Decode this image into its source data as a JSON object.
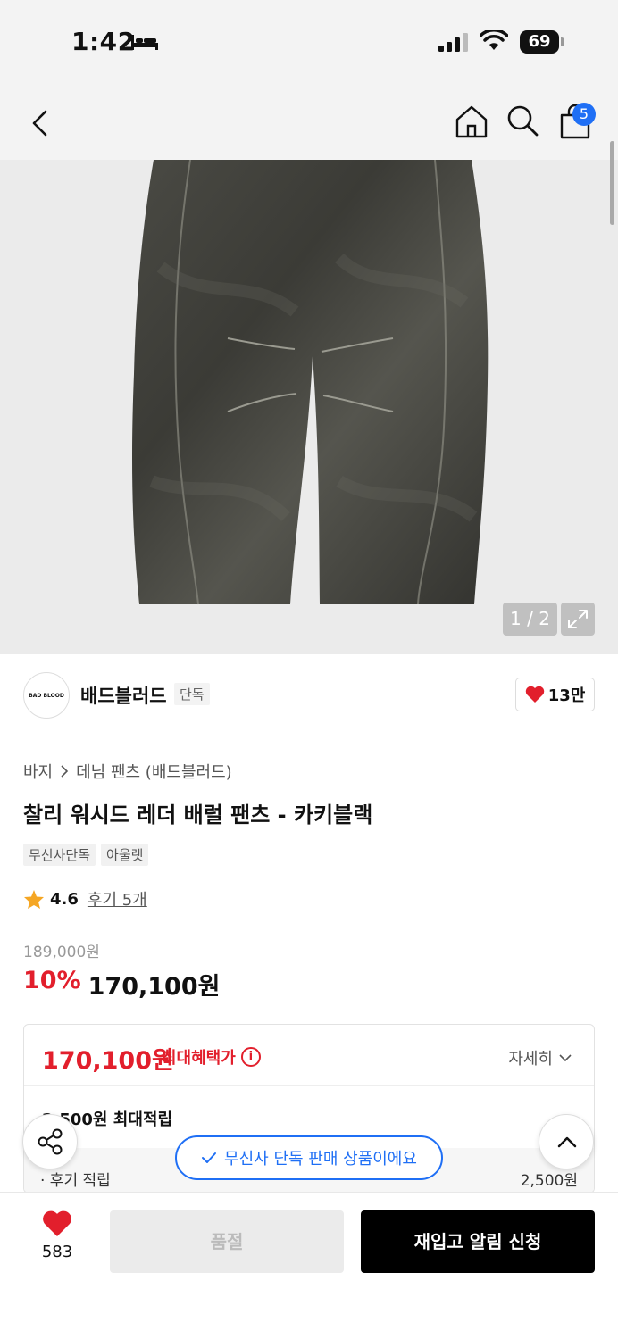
{
  "status": {
    "time": "1:42",
    "battery": "69"
  },
  "nav": {
    "cart_count": "5"
  },
  "gallery": {
    "counter": "1 / 2"
  },
  "brand": {
    "name": "배드블러드",
    "tag": "단독",
    "logo_text": "BAD BLOOD",
    "likes": "13만"
  },
  "breadcrumb": {
    "level1": "바지",
    "level2": "데님 팬츠 (배드블러드)"
  },
  "product": {
    "title": "찰리 워시드 레더 배럴 팬츠 - 카키블랙",
    "tags": [
      "무신사단독",
      "아울렛"
    ],
    "rating": "4.6",
    "reviews": "후기 5개",
    "original_price": "189,000원",
    "discount": "10%",
    "price": "170,100원"
  },
  "benefit": {
    "price": "170,100원",
    "label": "최대혜택가",
    "detail": "자세히",
    "points": "2,500원 최대적립",
    "review_label": "· 후기 적립",
    "review_value": "2,500원"
  },
  "banner": {
    "text": "무신사 단독 판매 상품이에요"
  },
  "bottom": {
    "wish_count": "583",
    "soldout": "품절",
    "restock": "재입고 알림 신청"
  },
  "colors": {
    "accent_red": "#e21f2c",
    "accent_blue": "#1f6ff5"
  }
}
